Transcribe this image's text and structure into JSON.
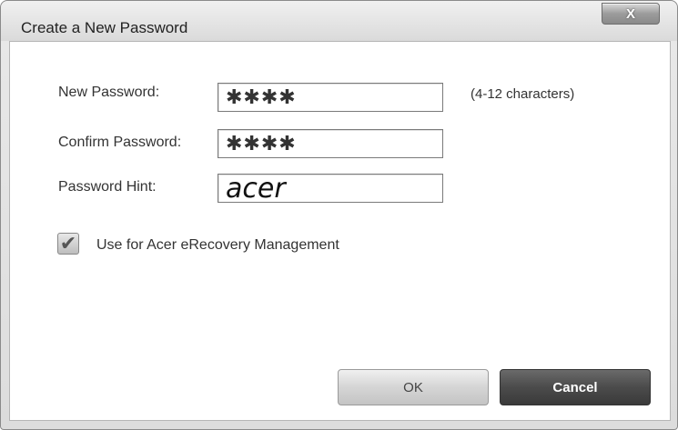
{
  "window": {
    "title": "Create a New Password",
    "close_glyph": "X"
  },
  "form": {
    "new_password": {
      "label": "New Password:",
      "value": "✱✱✱✱",
      "note": "(4-12 characters)"
    },
    "confirm_password": {
      "label": "Confirm Password:",
      "value": "✱✱✱✱"
    },
    "password_hint": {
      "label": "Password Hint:",
      "value": "acer"
    },
    "checkbox": {
      "checked": true,
      "label": "Use for Acer eRecovery Management"
    }
  },
  "buttons": {
    "ok_label": "OK",
    "cancel_label": "Cancel"
  },
  "icons": {
    "close": "close-icon",
    "check": "checkmark-icon"
  }
}
